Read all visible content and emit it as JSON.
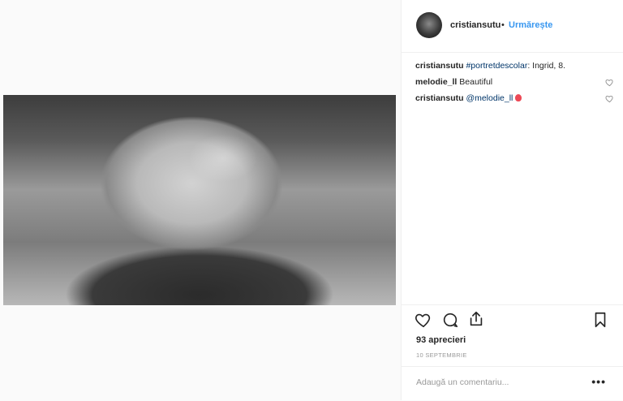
{
  "post": {
    "username": "cristiansutu",
    "separator": "•",
    "follow_label": "Urmărește"
  },
  "comments": [
    {
      "user": "cristiansutu",
      "link": "#portretdescolar",
      "text": ": Ingrid, 8."
    },
    {
      "user": "melodie_ll",
      "link": "",
      "text": "Beautiful"
    },
    {
      "user": "cristiansutu",
      "link": "@melodie_ll",
      "text": ""
    }
  ],
  "stats": {
    "likes": "93 aprecieri",
    "date": "10 SEPTEMBRIE"
  },
  "comment_box": {
    "placeholder": "Adaugă un comentariu...",
    "more": "•••"
  },
  "icons": [
    "heart-icon",
    "comment-icon",
    "share-icon",
    "bookmark-icon",
    "avatar",
    "balloon-emoji"
  ]
}
